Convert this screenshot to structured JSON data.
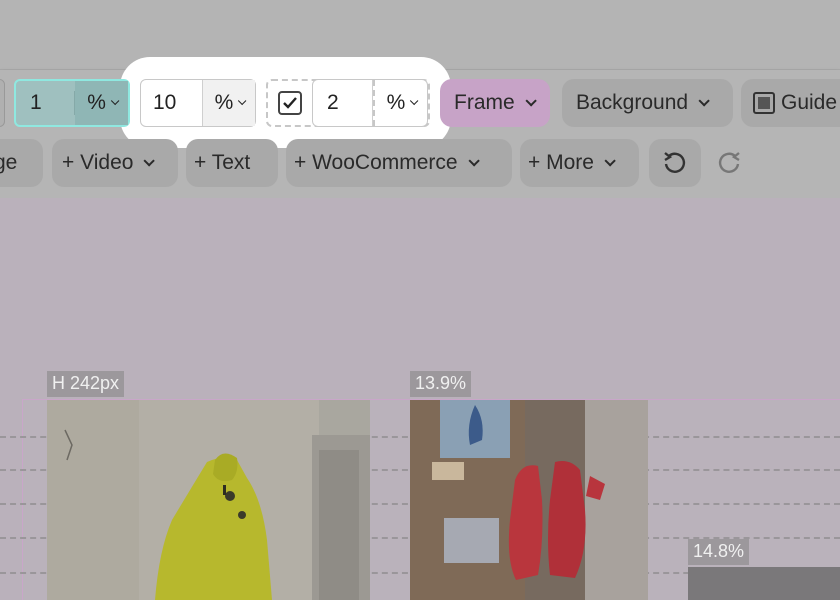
{
  "toolbar": {
    "row1": {
      "size_value": "1",
      "size_unit": "%",
      "gap_value": "10",
      "gap_unit": "%",
      "border_checkbox_checked": true,
      "border_value": "2",
      "border_unit": "%",
      "frame_label": "Frame",
      "background_label": "Background",
      "guides_label": "Guide"
    },
    "row2": {
      "image_partial": "ge",
      "video_label": "+ Video",
      "text_label": "+ Text",
      "woocommerce_label": "+ WooCommerce",
      "more_label": "+ More"
    }
  },
  "canvas": {
    "height_badge": "H 242px",
    "width_badge_1": "13.9%",
    "width_badge_2": "14.8%"
  },
  "colors": {
    "highlight_teal": "#9fc0bf",
    "frame_pink": "#c7a3c7",
    "canvas_bg": "#bab1bb",
    "toolbar_bg": "#b5b5b5"
  }
}
